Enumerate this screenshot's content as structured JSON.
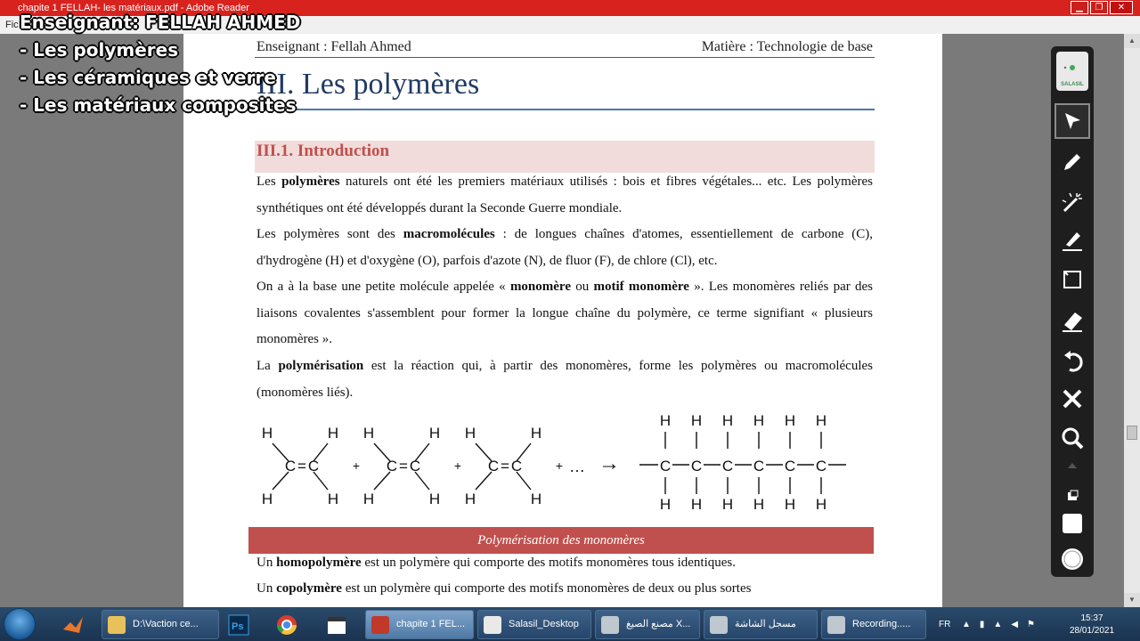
{
  "window": {
    "title": "chapite 1 FELLAH- les matériaux.pdf - Adobe Reader",
    "menu_partial_left": "Fic",
    "menu_partial_mid": "e",
    "buttons": {
      "minimize": "▁",
      "maximize": "❐",
      "close": "✕"
    }
  },
  "overlay": {
    "teacher": "Enseignant: FELLAH AHMED",
    "items": [
      "- Les polymères",
      "- Les céramiques et verre",
      "- Les matériaux composites"
    ]
  },
  "document": {
    "header_left": "Enseignant : Fellah Ahmed",
    "header_right": "Matière : Technologie de base",
    "chapter_title": "III. Les polymères",
    "section_title": "III.1. Introduction",
    "p1": [
      "Les ",
      "polymères",
      " naturels ont été les premiers matériaux utilisés : bois et fibres végétales... etc. Les polymères synthétiques ont été développés durant la Seconde Guerre mondiale."
    ],
    "p2": [
      "Les polymères sont des ",
      "macromolécules",
      " : de longues chaînes d'atomes, essentiellement de carbone (C), d'hydrogène (H) et d'oxygène (O), parfois d'azote (N), de fluor (F), de chlore (Cl), etc."
    ],
    "p3": [
      "On a à la base une petite molécule appelée « ",
      "monomère",
      " ou ",
      "motif monomère",
      " ». Les monomères reliés par des liaisons covalentes s'assemblent pour former la longue chaîne du polymère, ce terme signifiant « plusieurs monomères »."
    ],
    "p4": [
      "La ",
      "polymérisation",
      " est la réaction qui, à partir des monomères, forme les polymères ou macromolécules (monomères liés)."
    ],
    "figure_caption": "Polymérisation des monomères",
    "p5": [
      "Un ",
      "homopolymère",
      " est un polymère qui comporte des motifs monomères tous identiques."
    ],
    "p6": [
      "Un ",
      "copolymère",
      " est un polymère qui comporte des motifs monomères de deux ou plus sortes"
    ]
  },
  "chemistry": {
    "atom_h": "H",
    "atom_c": "C",
    "double_bond": "=",
    "plus": "+",
    "ellipsis": "…",
    "arrow": "→"
  },
  "salasil_toolbar": {
    "logo_text": "SALASIL",
    "tools": [
      "pointer-tool",
      "pen-tool",
      "laser-tool",
      "highlighter-tool",
      "whiteboard-tool",
      "eraser-tool",
      "undo-tool",
      "clear-tool",
      "zoom-tool"
    ],
    "selected_tool": "pointer-tool"
  },
  "taskbar": {
    "items": [
      {
        "label": "D:\\Vaction ce...",
        "icon_color": "#e8c15a"
      },
      {
        "label": "chapite 1 FEL...",
        "icon_color": "#c0392b",
        "active": true
      },
      {
        "label": "Salasil_Desktop",
        "icon_color": "#e9e9e9"
      },
      {
        "label": "مصنع الصيغ X...",
        "icon_color": "#bfc7cf"
      },
      {
        "label": "مسجل الشاشة",
        "icon_color": "#bfc7cf"
      },
      {
        "label": "Recording.....",
        "icon_color": "#bfc7cf"
      }
    ],
    "language": "FR",
    "time": "15:37",
    "date": "28/01/2021"
  },
  "colors": {
    "titlebar": "#d8221e",
    "chapter_title": "#1f3b63",
    "section_accent": "#c0504d",
    "section_band": "#f2dcdb",
    "toolbar_bg": "#1e1e1e"
  }
}
